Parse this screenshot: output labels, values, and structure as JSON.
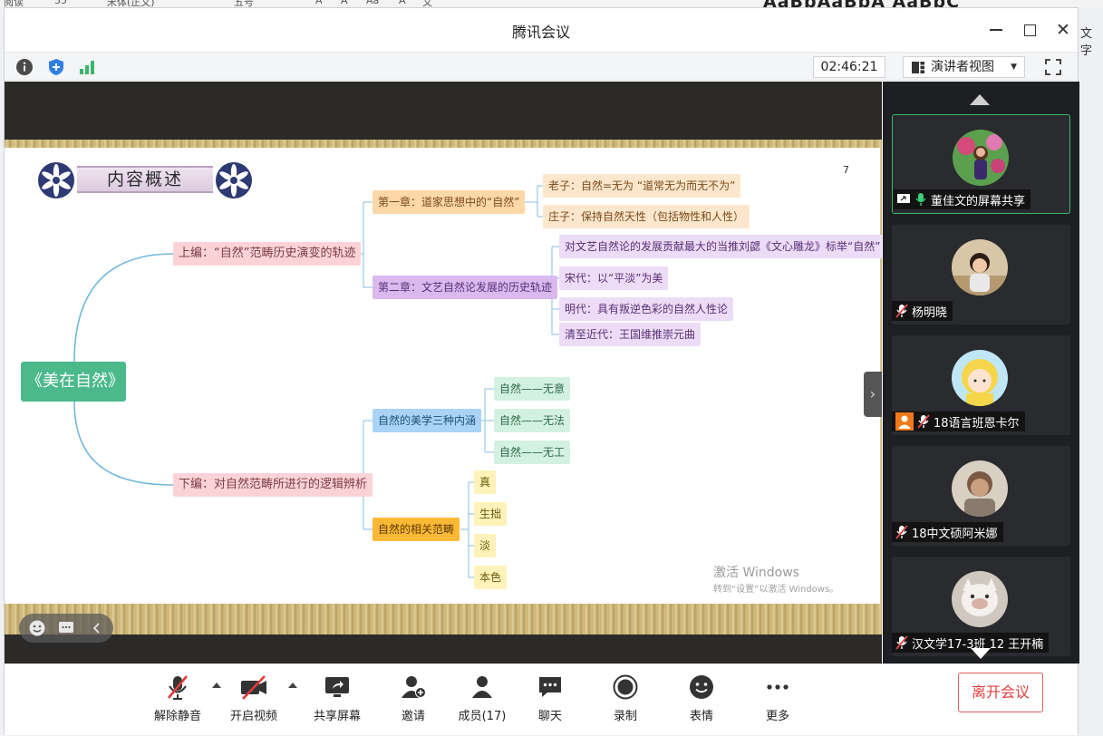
{
  "ribbon": {
    "fragments": [
      "阅读",
      "35",
      "宋体(正文)",
      "五号",
      "A",
      "A",
      "Aa",
      "A",
      "文"
    ],
    "styles": "AaBbAaBbA AaBbC",
    "side_text": "文字"
  },
  "window": {
    "title": "腾讯会议"
  },
  "infobar": {
    "timer": "02:46:21",
    "view_mode": "演讲者视图"
  },
  "slide": {
    "header": "内容概述",
    "page_number": "7",
    "root": "《美在自然》",
    "branches": [
      {
        "label": "上编：“自然”范畴历史演变的轨迹",
        "children": [
          {
            "label": "第一章：道家思想中的“自然”",
            "children": [
              "老子：自然=无为 “道常无为而无不为”",
              "庄子：保持自然天性（包括物性和人性）"
            ]
          },
          {
            "label": "第二章：文艺自然论发展的历史轨迹",
            "children": [
              "对文艺自然论的发展贡献最大的当推刘勰《文心雕龙》标举“自然”",
              "宋代：以“平淡”为美",
              "明代：具有叛逆色彩的自然人性论",
              "清至近代：王国维推崇元曲"
            ]
          }
        ]
      },
      {
        "label": "下编：对自然范畴所进行的逻辑辨析",
        "children": [
          {
            "label": "自然的美学三种内涵",
            "children": [
              "自然——无意",
              "自然——无法",
              "自然——无工"
            ]
          },
          {
            "label": "自然的相关范畴",
            "children": [
              "真",
              "生拙",
              "淡",
              "本色"
            ]
          }
        ]
      }
    ],
    "watermark_title": "激活 Windows",
    "watermark_sub": "转到“设置”以激活 Windows。"
  },
  "participants": [
    {
      "name": "董佳文的屏幕共享",
      "mic": "on",
      "sharing": true
    },
    {
      "name": "杨明晓",
      "mic": "muted"
    },
    {
      "name": "18语言班恩卡尔",
      "mic": "muted",
      "host_badge": true
    },
    {
      "name": "18中文硕阿米娜",
      "mic": "muted"
    },
    {
      "name": "汉文学17-3班 12 王开楠",
      "mic": "muted"
    }
  ],
  "toolbar": {
    "unmute": "解除静音",
    "start_video": "开启视频",
    "share_screen": "共享屏幕",
    "invite": "邀请",
    "members": "成员(17)",
    "chat": "聊天",
    "record": "录制",
    "reaction": "表情",
    "more": "更多",
    "leave": "离开会议"
  },
  "colors": {
    "accent_green": "#3bb56c",
    "leave_red": "#e0403f",
    "root_green": "#4bb98a"
  }
}
